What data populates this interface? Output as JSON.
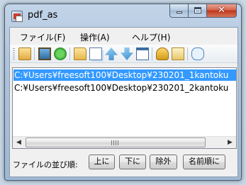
{
  "window": {
    "title": "pdf_as"
  },
  "menu": [
    {
      "label": "ファイル(F)"
    },
    {
      "label": "操作(A)"
    },
    {
      "label": "ヘルプ(H)"
    }
  ],
  "toolbar": {
    "icons": [
      "import-icon",
      "image-icon",
      "refresh-icon",
      "folder-icon",
      "copy-icon",
      "move-up-icon",
      "move-down-icon",
      "window-icon",
      "key-icon",
      "edit-icon",
      "comment-icon"
    ]
  },
  "files": [
    {
      "path": "C:¥Users¥freesoft100¥Desktop¥230201_1kantoku",
      "selected": true
    },
    {
      "path": "C:¥Users¥freesoft100¥Desktop¥230201_2kantoku",
      "selected": false
    }
  ],
  "scrollbar": {
    "left_arrow": "◀",
    "right_arrow": "▶"
  },
  "sort": {
    "label": "ファイルの並び順:",
    "up": "上に",
    "down": "下に",
    "remove": "除外",
    "by_name": "名前順に"
  },
  "colors": {
    "selection": "#3399ff",
    "frame": "#aec4dc"
  }
}
